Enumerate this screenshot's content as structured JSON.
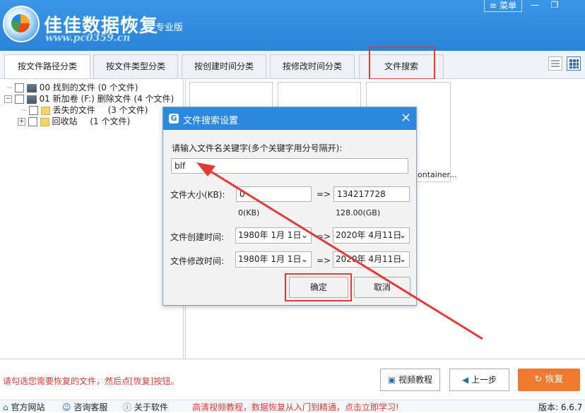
{
  "app": {
    "name": "佳佳数据恢复",
    "edition": "专业版",
    "watermark": "www.pc0359.cn",
    "menu_label": "菜单",
    "minimize": "—",
    "restore": "❐"
  },
  "tabs": [
    {
      "label": "按文件路径分类"
    },
    {
      "label": "按文件类型分类"
    },
    {
      "label": "按创建时间分类"
    },
    {
      "label": "按修改时间分类"
    },
    {
      "label": "文件搜索"
    }
  ],
  "tree": {
    "found": "00 找到的文件  (0 个文件)",
    "volume": "01 新加卷 (F:) 删除文件 (4 个文件)",
    "lost": "丢失的文件",
    "lost_count": "(3 个文件)",
    "recycle": "回收站",
    "recycle_count": "(1 个文件)"
  },
  "thumbs": {
    "third_label": "ontainer..."
  },
  "dialog": {
    "title": "文件搜索设置",
    "close": "×",
    "keyword_prompt": "请输入文件名关键字(多个关键字用分号隔开):",
    "keyword_value": "blf",
    "size_label": "文件大小(KB):",
    "size_from": "0",
    "size_to": "134217728",
    "size_from_hint": "0(KB)",
    "size_to_hint": "128.00(GB)",
    "arrow": "=>",
    "created_label": "文件创建时间:",
    "created_from": "1980年  1月  1日",
    "created_to": "2020年  4月11日",
    "modified_label": "文件修改时间:",
    "modified_from": "1980年  1月  1日",
    "modified_to": "2020年  4月11日",
    "ok": "确定",
    "cancel": "取消"
  },
  "bottom": {
    "hint": "请勾选您需要恢复的文件，然后点[恢复]按钮。",
    "video_btn": "视频教程",
    "back_btn": "上一步",
    "recover_btn": "恢复"
  },
  "status": {
    "website": "官方网站",
    "support": "咨询客服",
    "about": "关于软件",
    "promo": "高清视频教程，数据恢复从入门到精通，点击立即学习!",
    "version": "版本: 6.6.7"
  },
  "colors": {
    "header": "#2a84d8",
    "highlight": "#e53935",
    "recover_btn": "#f07a30"
  }
}
